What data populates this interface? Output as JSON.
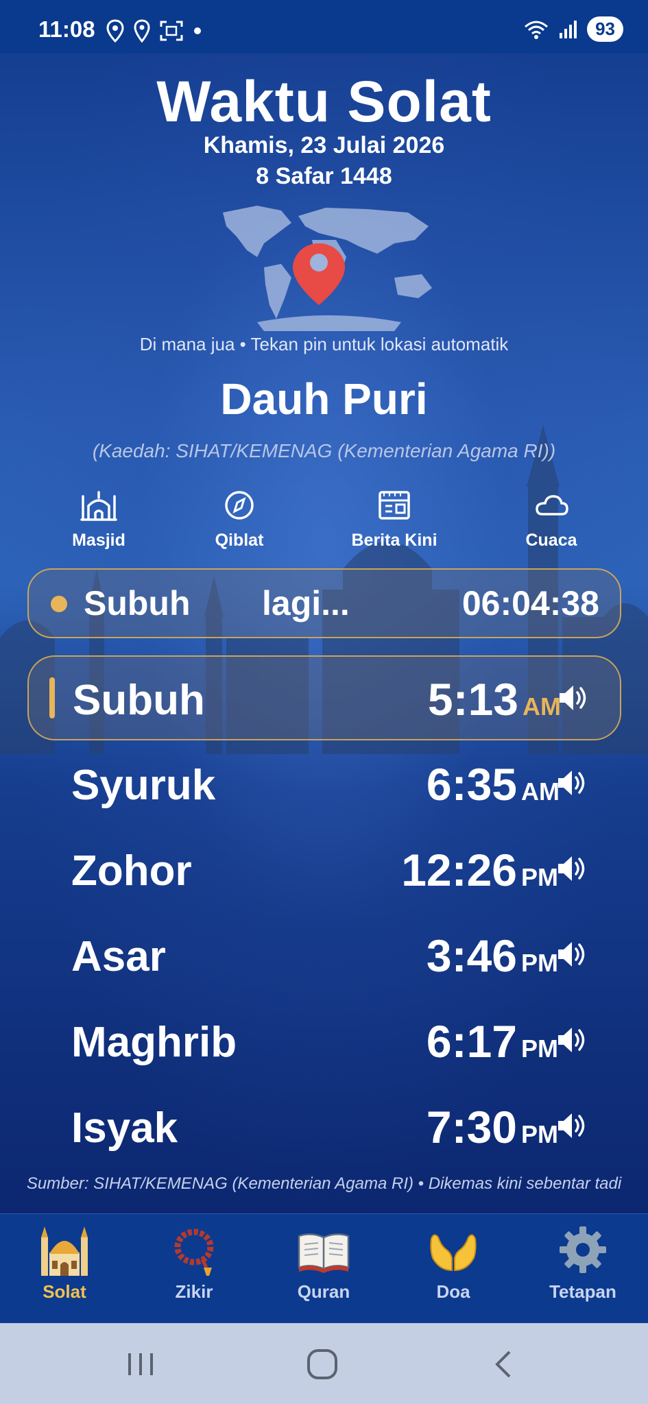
{
  "status_bar": {
    "time": "11:08",
    "battery": "93"
  },
  "header": {
    "title": "Waktu Solat",
    "date_gregorian": "Khamis, 23 Julai 2026",
    "date_hijri": "8 Safar 1448"
  },
  "location": {
    "hint": "Di mana jua • Tekan pin untuk lokasi automatik",
    "city": "Dauh Puri",
    "method": "(Kaedah: SIHAT/KEMENAG (Kementerian Agama RI))"
  },
  "quick_actions": [
    {
      "label": "Masjid",
      "icon": "mosque-icon"
    },
    {
      "label": "Qiblat",
      "icon": "compass-icon"
    },
    {
      "label": "Berita Kini",
      "icon": "news-icon"
    },
    {
      "label": "Cuaca",
      "icon": "cloud-icon"
    }
  ],
  "countdown": {
    "prayer": "Subuh",
    "text": "lagi...",
    "remaining": "06:04:38"
  },
  "prayers": [
    {
      "name": "Subuh",
      "time": "5:13",
      "period": "AM",
      "active": true
    },
    {
      "name": "Syuruk",
      "time": "6:35",
      "period": "AM",
      "active": false
    },
    {
      "name": "Zohor",
      "time": "12:26",
      "period": "PM",
      "active": false
    },
    {
      "name": "Asar",
      "time": "3:46",
      "period": "PM",
      "active": false
    },
    {
      "name": "Maghrib",
      "time": "6:17",
      "period": "PM",
      "active": false
    },
    {
      "name": "Isyak",
      "time": "7:30",
      "period": "PM",
      "active": false
    }
  ],
  "source": "Sumber: SIHAT/KEMENAG (Kementerian Agama RI) • Dikemas kini sebentar tadi",
  "bottom_nav": [
    {
      "label": "Solat",
      "icon": "mosque-emoji-icon",
      "active": true
    },
    {
      "label": "Zikir",
      "icon": "prayer-beads-icon",
      "active": false
    },
    {
      "label": "Quran",
      "icon": "open-book-icon",
      "active": false
    },
    {
      "label": "Doa",
      "icon": "praying-hands-icon",
      "active": false
    },
    {
      "label": "Tetapan",
      "icon": "gear-icon",
      "active": false
    }
  ],
  "colors": {
    "accent": "#e8b55a",
    "nav_active": "#f2c14e",
    "background": "#1a4aa0"
  }
}
